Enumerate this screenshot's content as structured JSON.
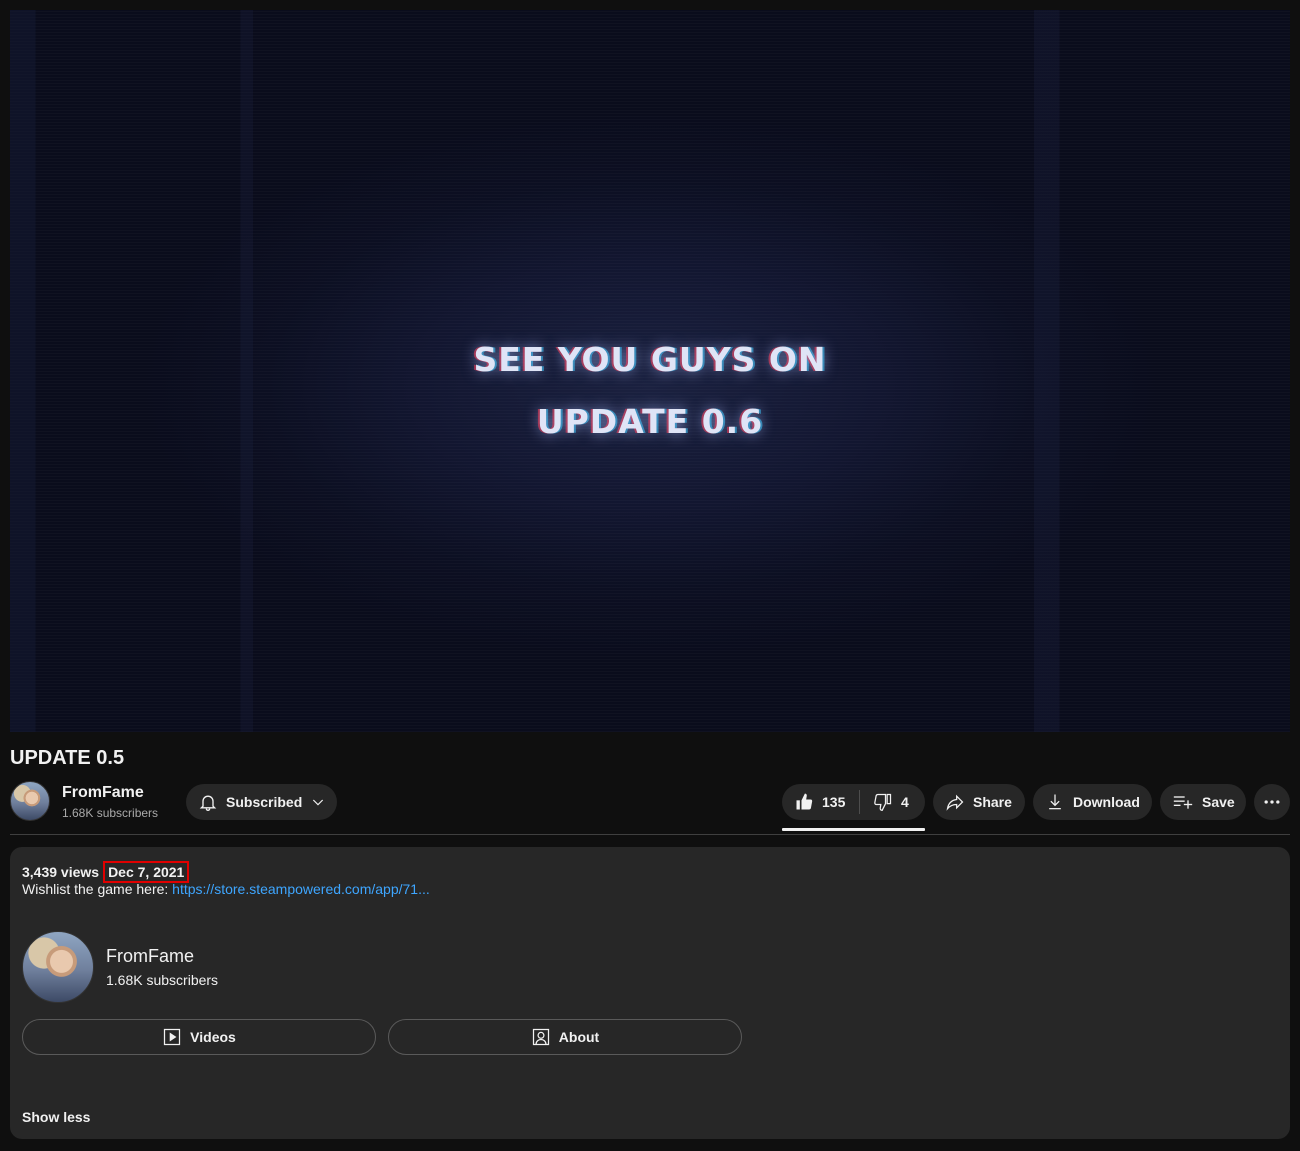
{
  "video": {
    "overlay_line1": "SEE YOU GUYS ON",
    "overlay_line2": "UPDATE 0.6"
  },
  "title": "UPDATE 0.5",
  "channel": {
    "name": "FromFame",
    "subscribers": "1.68K subscribers"
  },
  "actions": {
    "subscribed_label": "Subscribed",
    "like_count": "135",
    "dislike_count": "4",
    "share_label": "Share",
    "download_label": "Download",
    "save_label": "Save"
  },
  "description": {
    "views": "3,439 views",
    "date": "Dec 7, 2021",
    "text_prefix": "Wishlist the game here: ",
    "link": "https://store.steampowered.com/app/71...",
    "channel_name": "FromFame",
    "channel_subscribers": "1.68K subscribers",
    "videos_label": "Videos",
    "about_label": "About",
    "show_less": "Show less"
  },
  "colors": {
    "background": "#0f0f0f",
    "surface": "#272727",
    "link": "#3ea6ff",
    "highlight_box": "#e00000"
  }
}
